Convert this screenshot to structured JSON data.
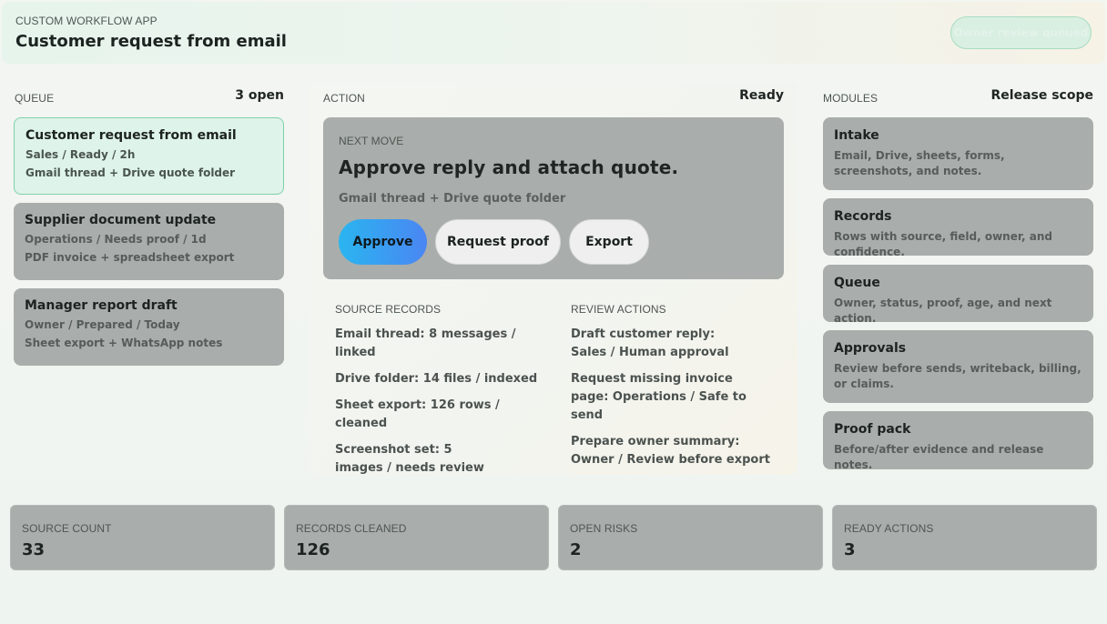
{
  "header": {
    "app_label": "CUSTOM WORKFLOW APP",
    "title": "Customer request from email",
    "status_pill": "Owner review queued"
  },
  "queue": {
    "heading": "QUEUE",
    "count": "3 open",
    "items": [
      {
        "title": "Customer request from email",
        "meta": "Sales / Ready / 2h",
        "source": "Gmail thread + Drive quote folder",
        "active": true
      },
      {
        "title": "Supplier document update",
        "meta": "Operations / Needs proof / 1d",
        "source": "PDF invoice + spreadsheet export",
        "active": false
      },
      {
        "title": "Manager report draft",
        "meta": "Owner / Prepared / Today",
        "source": "Sheet export + WhatsApp notes",
        "active": false
      }
    ]
  },
  "action": {
    "heading": "ACTION",
    "status": "Ready",
    "next_move": {
      "label": "NEXT MOVE",
      "title": "Approve reply and attach quote.",
      "source": "Gmail thread + Drive quote folder",
      "buttons": {
        "approve": "Approve",
        "request_proof": "Request proof",
        "export": "Export"
      }
    },
    "source_records": {
      "label": "SOURCE RECORDS",
      "items": [
        "Email thread: 8 messages / linked",
        "Drive folder: 14 files / indexed",
        "Sheet export: 126 rows / cleaned",
        "Screenshot set: 5 images / needs review"
      ]
    },
    "review_actions": {
      "label": "REVIEW ACTIONS",
      "items": [
        "Draft customer reply: Sales / Human approval",
        "Request missing invoice page: Operations / Safe to send",
        "Prepare owner summary: Owner / Review before export"
      ]
    }
  },
  "modules": {
    "heading": "MODULES",
    "scope": "Release scope",
    "items": [
      {
        "title": "Intake",
        "desc": "Email, Drive, sheets, forms, screenshots, and notes."
      },
      {
        "title": "Records",
        "desc": "Rows with source, field, owner, and confidence."
      },
      {
        "title": "Queue",
        "desc": "Owner, status, proof, age, and next action."
      },
      {
        "title": "Approvals",
        "desc": "Review before sends, writeback, billing, or claims."
      },
      {
        "title": "Proof pack",
        "desc": "Before/after evidence and release notes."
      }
    ]
  },
  "stats": [
    {
      "label": "SOURCE COUNT",
      "value": "33"
    },
    {
      "label": "RECORDS CLEANED",
      "value": "126"
    },
    {
      "label": "OPEN RISKS",
      "value": "2"
    },
    {
      "label": "READY ACTIONS",
      "value": "3"
    }
  ]
}
